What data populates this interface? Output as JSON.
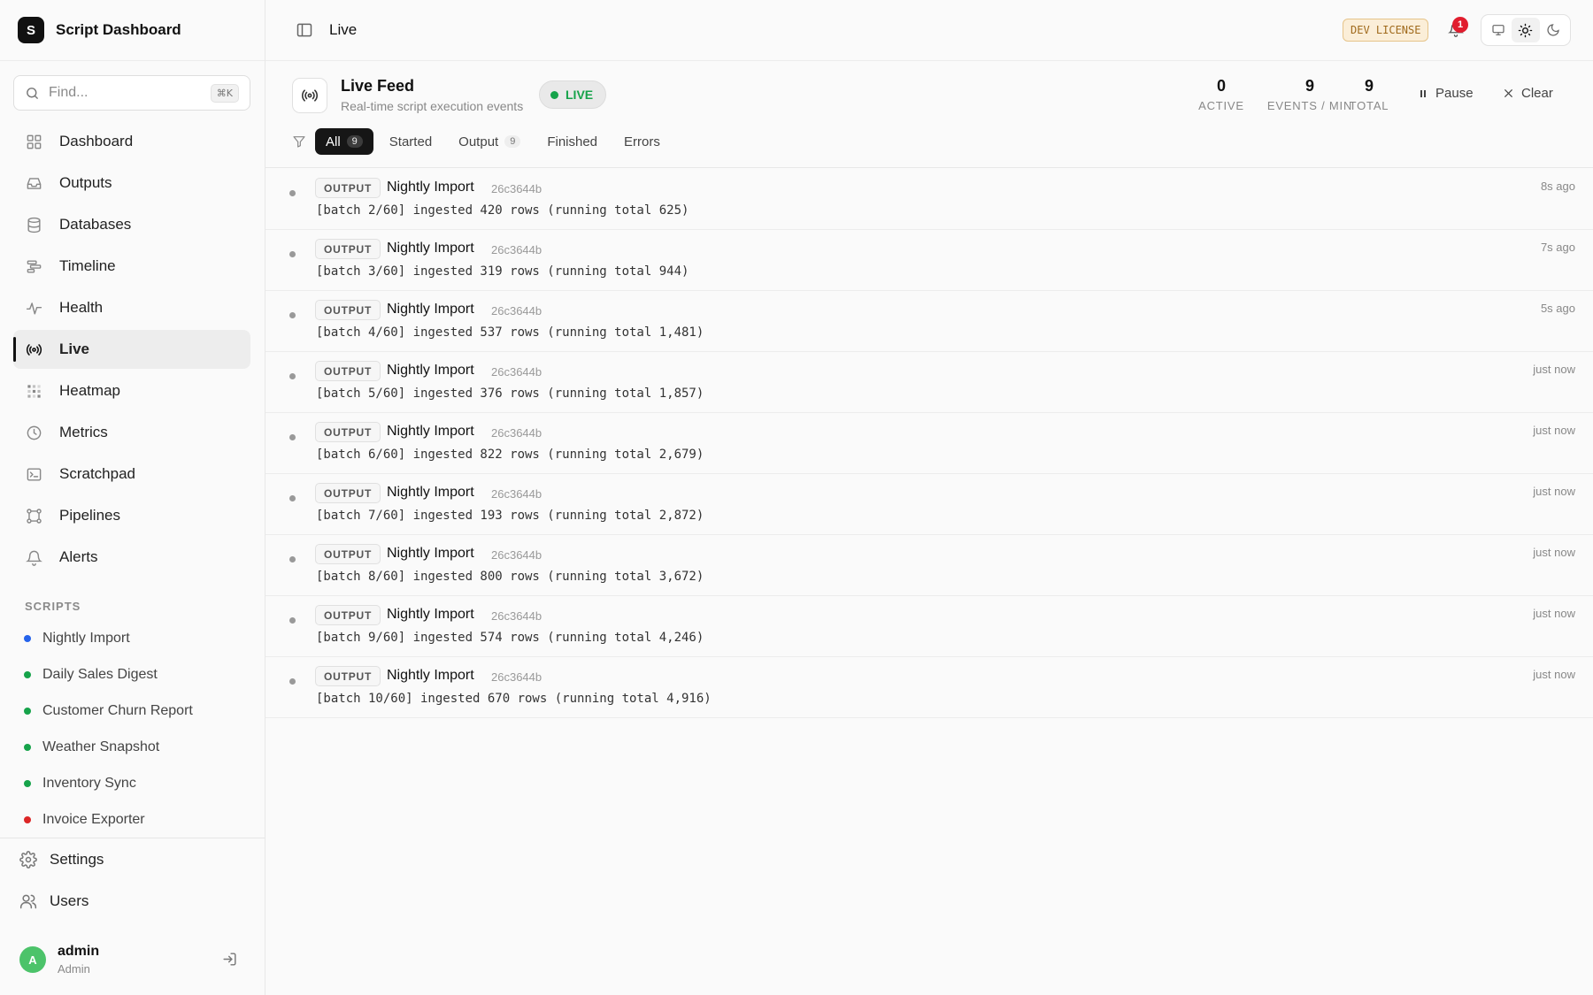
{
  "app": {
    "logo_letter": "S",
    "name": "Script Dashboard"
  },
  "search": {
    "placeholder": "Find...",
    "shortcut": "⌘K"
  },
  "nav": [
    {
      "label": "Dashboard",
      "icon": "grid-icon",
      "active": false
    },
    {
      "label": "Outputs",
      "icon": "inbox-icon",
      "active": false
    },
    {
      "label": "Databases",
      "icon": "database-icon",
      "active": false
    },
    {
      "label": "Timeline",
      "icon": "timeline-icon",
      "active": false
    },
    {
      "label": "Health",
      "icon": "activity-icon",
      "active": false
    },
    {
      "label": "Live",
      "icon": "broadcast-icon",
      "active": true
    },
    {
      "label": "Heatmap",
      "icon": "heatmap-icon",
      "active": false
    },
    {
      "label": "Metrics",
      "icon": "clock-icon",
      "active": false
    },
    {
      "label": "Scratchpad",
      "icon": "terminal-icon",
      "active": false
    },
    {
      "label": "Pipelines",
      "icon": "pipeline-icon",
      "active": false
    },
    {
      "label": "Alerts",
      "icon": "bell-icon",
      "active": false
    }
  ],
  "scripts_title": "SCRIPTS",
  "scripts": [
    {
      "label": "Nightly Import",
      "color": "#2563eb"
    },
    {
      "label": "Daily Sales Digest",
      "color": "#16a34a"
    },
    {
      "label": "Customer Churn Report",
      "color": "#16a34a"
    },
    {
      "label": "Weather Snapshot",
      "color": "#16a34a"
    },
    {
      "label": "Inventory Sync",
      "color": "#16a34a"
    },
    {
      "label": "Invoice Exporter",
      "color": "#dc2626"
    }
  ],
  "bottom": {
    "settings": "Settings",
    "users": "Users"
  },
  "user": {
    "initial": "A",
    "name": "admin",
    "role": "Admin"
  },
  "header": {
    "title": "Live",
    "license": "DEV LICENSE",
    "notifications": "1"
  },
  "feed": {
    "title": "Live Feed",
    "subtitle": "Real-time script execution events",
    "live_label": "LIVE",
    "stats": [
      {
        "value": "0",
        "label": "ACTIVE"
      },
      {
        "value": "9",
        "label": "EVENTS / MIN"
      },
      {
        "value": "9",
        "label": "TOTAL"
      }
    ],
    "pause_label": "Pause",
    "clear_label": "Clear",
    "filters": [
      {
        "label": "All",
        "count": "9",
        "active": true
      },
      {
        "label": "Started",
        "count": null,
        "active": false
      },
      {
        "label": "Output",
        "count": "9",
        "active": false
      },
      {
        "label": "Finished",
        "count": null,
        "active": false
      },
      {
        "label": "Errors",
        "count": null,
        "active": false
      }
    ]
  },
  "events": [
    {
      "tag": "OUTPUT",
      "script": "Nightly Import",
      "hash": "26c3644b",
      "message": "[batch 2/60] ingested 420 rows (running total 625)",
      "time": "8s ago"
    },
    {
      "tag": "OUTPUT",
      "script": "Nightly Import",
      "hash": "26c3644b",
      "message": "[batch 3/60] ingested 319 rows (running total 944)",
      "time": "7s ago"
    },
    {
      "tag": "OUTPUT",
      "script": "Nightly Import",
      "hash": "26c3644b",
      "message": "[batch 4/60] ingested 537 rows (running total 1,481)",
      "time": "5s ago"
    },
    {
      "tag": "OUTPUT",
      "script": "Nightly Import",
      "hash": "26c3644b",
      "message": "[batch 5/60] ingested 376 rows (running total 1,857)",
      "time": "just now"
    },
    {
      "tag": "OUTPUT",
      "script": "Nightly Import",
      "hash": "26c3644b",
      "message": "[batch 6/60] ingested 822 rows (running total 2,679)",
      "time": "just now"
    },
    {
      "tag": "OUTPUT",
      "script": "Nightly Import",
      "hash": "26c3644b",
      "message": "[batch 7/60] ingested 193 rows (running total 2,872)",
      "time": "just now"
    },
    {
      "tag": "OUTPUT",
      "script": "Nightly Import",
      "hash": "26c3644b",
      "message": "[batch 8/60] ingested 800 rows (running total 3,672)",
      "time": "just now"
    },
    {
      "tag": "OUTPUT",
      "script": "Nightly Import",
      "hash": "26c3644b",
      "message": "[batch 9/60] ingested 574 rows (running total 4,246)",
      "time": "just now"
    },
    {
      "tag": "OUTPUT",
      "script": "Nightly Import",
      "hash": "26c3644b",
      "message": "[batch 10/60] ingested 670 rows (running total 4,916)",
      "time": "just now"
    }
  ]
}
